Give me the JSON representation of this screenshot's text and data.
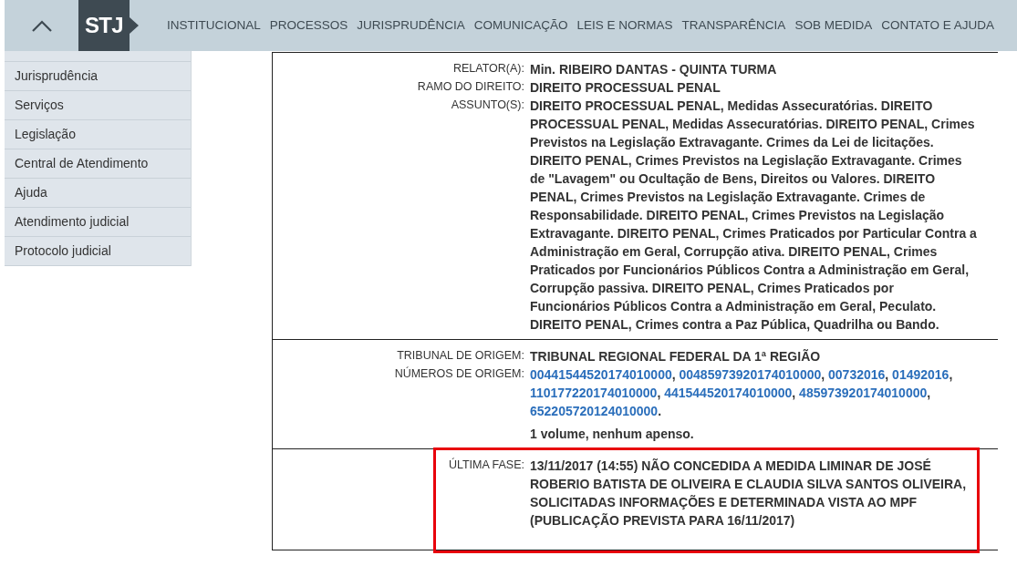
{
  "header": {
    "logo": "STJ",
    "nav": [
      "INSTITUCIONAL",
      "PROCESSOS",
      "JURISPRUDÊNCIA",
      "COMUNICAÇÃO",
      "LEIS E NORMAS",
      "TRANSPARÊNCIA",
      "SOB MEDIDA",
      "CONTATO E AJUDA"
    ]
  },
  "sidebar": {
    "items": [
      "Jurisprudência",
      "Serviços",
      "Legislação",
      "Central de Atendimento",
      "Ajuda",
      "Atendimento judicial",
      "Protocolo judicial"
    ]
  },
  "sections": [
    {
      "highlighted": false,
      "fields": [
        {
          "kind": "text",
          "label": "RELATOR(A):",
          "value": "Min. RIBEIRO DANTAS - QUINTA TURMA"
        },
        {
          "kind": "text",
          "label": "RAMO DO DIREITO:",
          "value": "DIREITO PROCESSUAL PENAL"
        },
        {
          "kind": "text",
          "label": "ASSUNTO(S):",
          "value": "DIREITO PROCESSUAL PENAL, Medidas Assecuratórias. DIREITO PROCESSUAL PENAL, Medidas Assecuratórias. DIREITO PENAL, Crimes Previstos na Legislação Extravagante. Crimes da Lei de licitações. DIREITO PENAL, Crimes Previstos na Legislação Extravagante. Crimes de \"Lavagem\" ou Ocultação de Bens, Direitos ou Valores. DIREITO PENAL, Crimes Previstos na Legislação Extravagante. Crimes de Responsabilidade. DIREITO PENAL, Crimes Previstos na Legislação Extravagante. DIREITO PENAL, Crimes Praticados por Particular Contra a Administração em Geral, Corrupção ativa. DIREITO PENAL, Crimes Praticados por Funcionários Públicos Contra a Administração em Geral, Corrupção passiva. DIREITO PENAL, Crimes Praticados por Funcionários Públicos Contra a Administração em Geral, Peculato. DIREITO PENAL, Crimes contra a Paz Pública, Quadrilha ou Bando."
        }
      ]
    },
    {
      "highlighted": false,
      "fields": [
        {
          "kind": "text",
          "label": "TRIBUNAL DE ORIGEM:",
          "value": "TRIBUNAL REGIONAL FEDERAL DA 1ª REGIÃO"
        },
        {
          "kind": "links",
          "label": "NÚMEROS DE ORIGEM:",
          "links": [
            {
              "text": "00441544520174010000",
              "separator": ","
            },
            {
              "text": "00485973920174010000",
              "separator": ","
            },
            {
              "text": "00732016",
              "separator": ","
            },
            {
              "text": "01492016",
              "separator": ","
            },
            {
              "text": "110177220174010000",
              "separator": ","
            },
            {
              "text": "441544520174010000",
              "separator": ","
            },
            {
              "text": "485973920174010000",
              "separator": ","
            },
            {
              "text": "652205720124010000",
              "separator": "."
            }
          ]
        },
        {
          "kind": "note",
          "value": "1 volume, nenhum apenso."
        }
      ]
    },
    {
      "highlighted": true,
      "fields": [
        {
          "kind": "text",
          "label": "ÚLTIMA FASE:",
          "value": "13/11/2017 (14:55) NÃO CONCEDIDA A MEDIDA LIMINAR DE JOSÉ ROBERIO BATISTA DE OLIVEIRA E CLAUDIA SILVA SANTOS OLIVEIRA, SOLICITADAS INFORMAÇÕES E DETERMINADA VISTA AO MPF (PUBLICAÇÃO PREVISTA PARA 16/11/2017)"
        }
      ]
    }
  ]
}
